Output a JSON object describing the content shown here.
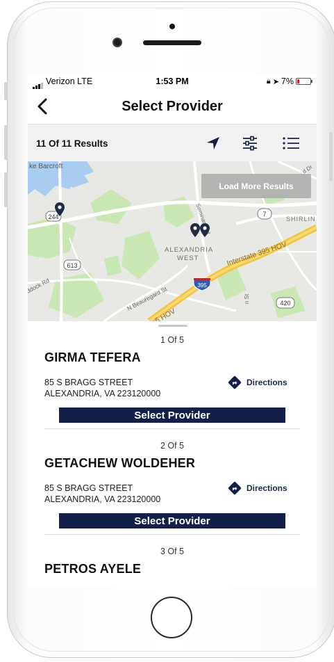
{
  "status_bar": {
    "carrier": "Verizon  LTE",
    "time": "1:53 PM",
    "battery": "7%",
    "battery_level": 0.07,
    "battery_color": "#e8112d"
  },
  "header": {
    "title": "Select Provider",
    "back_icon": "chevron-left-icon"
  },
  "results_bar": {
    "count_text": "11 Of 11 Results",
    "icons": [
      "location-arrow-icon",
      "filter-sliders-icon",
      "list-icon"
    ],
    "icon_color": "#14204a"
  },
  "map": {
    "load_more_label": "Load More Results",
    "labels": {
      "barcroft": "ke Barcroft",
      "alexandria": "ALEXANDRIA",
      "west": "WEST",
      "interstate": "Interstate 395 HOV",
      "hov": "5 HOV",
      "shirlington": "SHIRLIN",
      "beauregard": "N Beauregard St",
      "braddock": "ddock Rd",
      "seminary": "Seminary Rd",
      "n_st": "n St",
      "dr": "d Dr",
      "route_244": "244",
      "route_613": "613",
      "route_7": "7",
      "route_420": "420",
      "route_395": "395"
    },
    "marker_color": "#1f2a44"
  },
  "providers": [
    {
      "index_label": "1 Of 5",
      "name": "GIRMA TEFERA",
      "address_line1": "85 S BRAGG STREET",
      "address_line2": "ALEXANDRIA, VA 223120000",
      "directions_label": "Directions",
      "select_label": "Select Provider"
    },
    {
      "index_label": "2 Of 5",
      "name": "GETACHEW WOLDEHER",
      "address_line1": "85 S BRAGG STREET",
      "address_line2": "ALEXANDRIA, VA 223120000",
      "directions_label": "Directions",
      "select_label": "Select Provider"
    },
    {
      "index_label": "3 Of 5",
      "name": "PETROS AYELE"
    }
  ],
  "colors": {
    "brand_navy": "#14204a",
    "load_more_bg": "#b0b0b0"
  }
}
